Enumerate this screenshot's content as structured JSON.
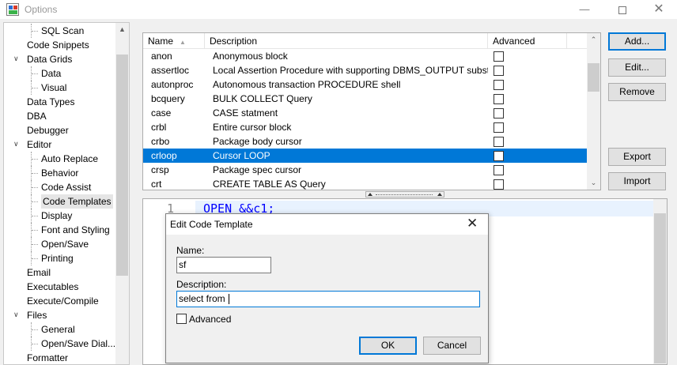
{
  "window": {
    "title": "Options",
    "minimize_glyph": "—",
    "close_glyph": "✕"
  },
  "tree": {
    "items": [
      {
        "label": "SQL Scan",
        "level": 2,
        "toggle": ""
      },
      {
        "label": "Code Snippets",
        "level": 1,
        "toggle": ""
      },
      {
        "label": "Data Grids",
        "level": 1,
        "toggle": "∨"
      },
      {
        "label": "Data",
        "level": 2,
        "toggle": ""
      },
      {
        "label": "Visual",
        "level": 2,
        "toggle": ""
      },
      {
        "label": "Data Types",
        "level": 1,
        "toggle": ""
      },
      {
        "label": "DBA",
        "level": 1,
        "toggle": ""
      },
      {
        "label": "Debugger",
        "level": 1,
        "toggle": ""
      },
      {
        "label": "Editor",
        "level": 1,
        "toggle": "∨"
      },
      {
        "label": "Auto Replace",
        "level": 2,
        "toggle": ""
      },
      {
        "label": "Behavior",
        "level": 2,
        "toggle": ""
      },
      {
        "label": "Code Assist",
        "level": 2,
        "toggle": ""
      },
      {
        "label": "Code Templates",
        "level": 2,
        "toggle": "",
        "selected": true
      },
      {
        "label": "Display",
        "level": 2,
        "toggle": ""
      },
      {
        "label": "Font and Styling",
        "level": 2,
        "toggle": ""
      },
      {
        "label": "Open/Save",
        "level": 2,
        "toggle": ""
      },
      {
        "label": "Printing",
        "level": 2,
        "toggle": ""
      },
      {
        "label": "Email",
        "level": 1,
        "toggle": ""
      },
      {
        "label": "Executables",
        "level": 1,
        "toggle": ""
      },
      {
        "label": "Execute/Compile",
        "level": 1,
        "toggle": ""
      },
      {
        "label": "Files",
        "level": 1,
        "toggle": "∨"
      },
      {
        "label": "General",
        "level": 2,
        "toggle": ""
      },
      {
        "label": "Open/Save Dial...",
        "level": 2,
        "toggle": ""
      },
      {
        "label": "Formatter",
        "level": 1,
        "toggle": ""
      }
    ]
  },
  "templates": {
    "columns": {
      "name": "Name",
      "description": "Description",
      "advanced": "Advanced"
    },
    "rows": [
      {
        "name": "anon",
        "description": "Anonymous block",
        "advanced": false
      },
      {
        "name": "assertloc",
        "description": "Local Assertion Procedure with supporting DBMS_OUTPUT substitute",
        "advanced": false
      },
      {
        "name": "autonproc",
        "description": "Autonomous transaction PROCEDURE shell",
        "advanced": false
      },
      {
        "name": "bcquery",
        "description": "BULK COLLECT Query",
        "advanced": false
      },
      {
        "name": "case",
        "description": "CASE statment",
        "advanced": false
      },
      {
        "name": "crbl",
        "description": "Entire cursor block",
        "advanced": false
      },
      {
        "name": "crbo",
        "description": "Package body cursor",
        "advanced": false
      },
      {
        "name": "crloop",
        "description": "Cursor LOOP",
        "advanced": false,
        "selected": true
      },
      {
        "name": "crsp",
        "description": "Package spec cursor",
        "advanced": false
      },
      {
        "name": "crt",
        "description": "CREATE TABLE AS Query",
        "advanced": false
      }
    ]
  },
  "buttons": {
    "add": "Add...",
    "edit": "Edit...",
    "remove": "Remove",
    "export": "Export",
    "import": "Import"
  },
  "editor": {
    "line_number": "1",
    "code": "OPEN &&c1;"
  },
  "dialog": {
    "title": "Edit Code Template",
    "name_label": "Name:",
    "name_value": "sf",
    "description_label": "Description:",
    "description_value": "select from ",
    "advanced_label": "Advanced",
    "ok": "OK",
    "cancel": "Cancel"
  }
}
